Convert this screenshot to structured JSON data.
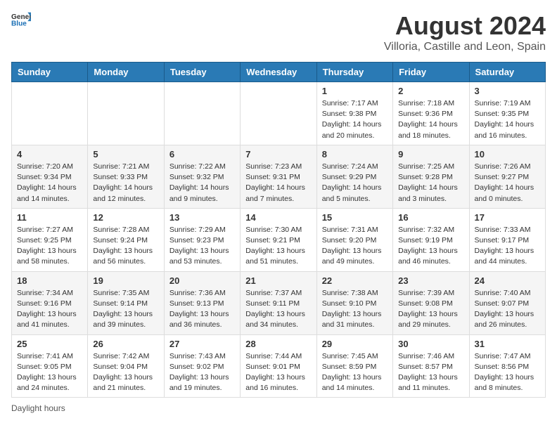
{
  "header": {
    "logo_general": "General",
    "logo_blue": "Blue",
    "main_title": "August 2024",
    "subtitle": "Villoria, Castille and Leon, Spain"
  },
  "days_of_week": [
    "Sunday",
    "Monday",
    "Tuesday",
    "Wednesday",
    "Thursday",
    "Friday",
    "Saturday"
  ],
  "weeks": [
    [
      {
        "day": "",
        "info": ""
      },
      {
        "day": "",
        "info": ""
      },
      {
        "day": "",
        "info": ""
      },
      {
        "day": "",
        "info": ""
      },
      {
        "day": "1",
        "info": "Sunrise: 7:17 AM\nSunset: 9:38 PM\nDaylight: 14 hours and 20 minutes."
      },
      {
        "day": "2",
        "info": "Sunrise: 7:18 AM\nSunset: 9:36 PM\nDaylight: 14 hours and 18 minutes."
      },
      {
        "day": "3",
        "info": "Sunrise: 7:19 AM\nSunset: 9:35 PM\nDaylight: 14 hours and 16 minutes."
      }
    ],
    [
      {
        "day": "4",
        "info": "Sunrise: 7:20 AM\nSunset: 9:34 PM\nDaylight: 14 hours and 14 minutes."
      },
      {
        "day": "5",
        "info": "Sunrise: 7:21 AM\nSunset: 9:33 PM\nDaylight: 14 hours and 12 minutes."
      },
      {
        "day": "6",
        "info": "Sunrise: 7:22 AM\nSunset: 9:32 PM\nDaylight: 14 hours and 9 minutes."
      },
      {
        "day": "7",
        "info": "Sunrise: 7:23 AM\nSunset: 9:31 PM\nDaylight: 14 hours and 7 minutes."
      },
      {
        "day": "8",
        "info": "Sunrise: 7:24 AM\nSunset: 9:29 PM\nDaylight: 14 hours and 5 minutes."
      },
      {
        "day": "9",
        "info": "Sunrise: 7:25 AM\nSunset: 9:28 PM\nDaylight: 14 hours and 3 minutes."
      },
      {
        "day": "10",
        "info": "Sunrise: 7:26 AM\nSunset: 9:27 PM\nDaylight: 14 hours and 0 minutes."
      }
    ],
    [
      {
        "day": "11",
        "info": "Sunrise: 7:27 AM\nSunset: 9:25 PM\nDaylight: 13 hours and 58 minutes."
      },
      {
        "day": "12",
        "info": "Sunrise: 7:28 AM\nSunset: 9:24 PM\nDaylight: 13 hours and 56 minutes."
      },
      {
        "day": "13",
        "info": "Sunrise: 7:29 AM\nSunset: 9:23 PM\nDaylight: 13 hours and 53 minutes."
      },
      {
        "day": "14",
        "info": "Sunrise: 7:30 AM\nSunset: 9:21 PM\nDaylight: 13 hours and 51 minutes."
      },
      {
        "day": "15",
        "info": "Sunrise: 7:31 AM\nSunset: 9:20 PM\nDaylight: 13 hours and 49 minutes."
      },
      {
        "day": "16",
        "info": "Sunrise: 7:32 AM\nSunset: 9:19 PM\nDaylight: 13 hours and 46 minutes."
      },
      {
        "day": "17",
        "info": "Sunrise: 7:33 AM\nSunset: 9:17 PM\nDaylight: 13 hours and 44 minutes."
      }
    ],
    [
      {
        "day": "18",
        "info": "Sunrise: 7:34 AM\nSunset: 9:16 PM\nDaylight: 13 hours and 41 minutes."
      },
      {
        "day": "19",
        "info": "Sunrise: 7:35 AM\nSunset: 9:14 PM\nDaylight: 13 hours and 39 minutes."
      },
      {
        "day": "20",
        "info": "Sunrise: 7:36 AM\nSunset: 9:13 PM\nDaylight: 13 hours and 36 minutes."
      },
      {
        "day": "21",
        "info": "Sunrise: 7:37 AM\nSunset: 9:11 PM\nDaylight: 13 hours and 34 minutes."
      },
      {
        "day": "22",
        "info": "Sunrise: 7:38 AM\nSunset: 9:10 PM\nDaylight: 13 hours and 31 minutes."
      },
      {
        "day": "23",
        "info": "Sunrise: 7:39 AM\nSunset: 9:08 PM\nDaylight: 13 hours and 29 minutes."
      },
      {
        "day": "24",
        "info": "Sunrise: 7:40 AM\nSunset: 9:07 PM\nDaylight: 13 hours and 26 minutes."
      }
    ],
    [
      {
        "day": "25",
        "info": "Sunrise: 7:41 AM\nSunset: 9:05 PM\nDaylight: 13 hours and 24 minutes."
      },
      {
        "day": "26",
        "info": "Sunrise: 7:42 AM\nSunset: 9:04 PM\nDaylight: 13 hours and 21 minutes."
      },
      {
        "day": "27",
        "info": "Sunrise: 7:43 AM\nSunset: 9:02 PM\nDaylight: 13 hours and 19 minutes."
      },
      {
        "day": "28",
        "info": "Sunrise: 7:44 AM\nSunset: 9:01 PM\nDaylight: 13 hours and 16 minutes."
      },
      {
        "day": "29",
        "info": "Sunrise: 7:45 AM\nSunset: 8:59 PM\nDaylight: 13 hours and 14 minutes."
      },
      {
        "day": "30",
        "info": "Sunrise: 7:46 AM\nSunset: 8:57 PM\nDaylight: 13 hours and 11 minutes."
      },
      {
        "day": "31",
        "info": "Sunrise: 7:47 AM\nSunset: 8:56 PM\nDaylight: 13 hours and 8 minutes."
      }
    ]
  ],
  "footer": {
    "daylight_label": "Daylight hours"
  }
}
